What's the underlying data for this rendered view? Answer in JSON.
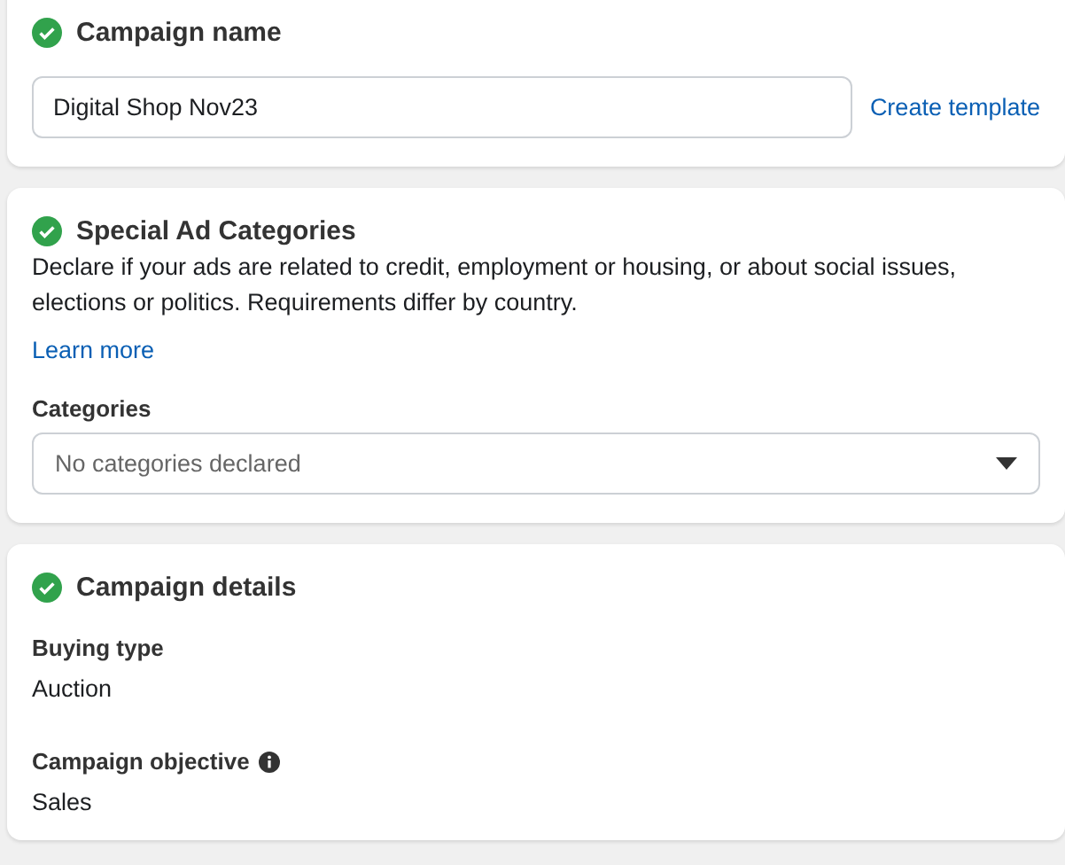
{
  "sections": [
    {
      "kind": "name",
      "title": "Campaign name",
      "complete": true,
      "value": "Digital Shop Nov23",
      "link": "Create template"
    },
    {
      "kind": "categories",
      "title": "Special Ad Categories",
      "complete": true,
      "description": "Declare if your ads are related to credit, employment or housing, or about social issues, elections or politics. Requirements differ by country.",
      "link": "Learn more",
      "field_label": "Categories",
      "placeholder": "No categories declared"
    },
    {
      "kind": "details",
      "title": "Campaign details",
      "complete": true,
      "fields": [
        {
          "label": "Buying type",
          "value": "Auction",
          "info": false
        },
        {
          "label": "Campaign objective",
          "value": "Sales",
          "info": true
        }
      ]
    }
  ]
}
